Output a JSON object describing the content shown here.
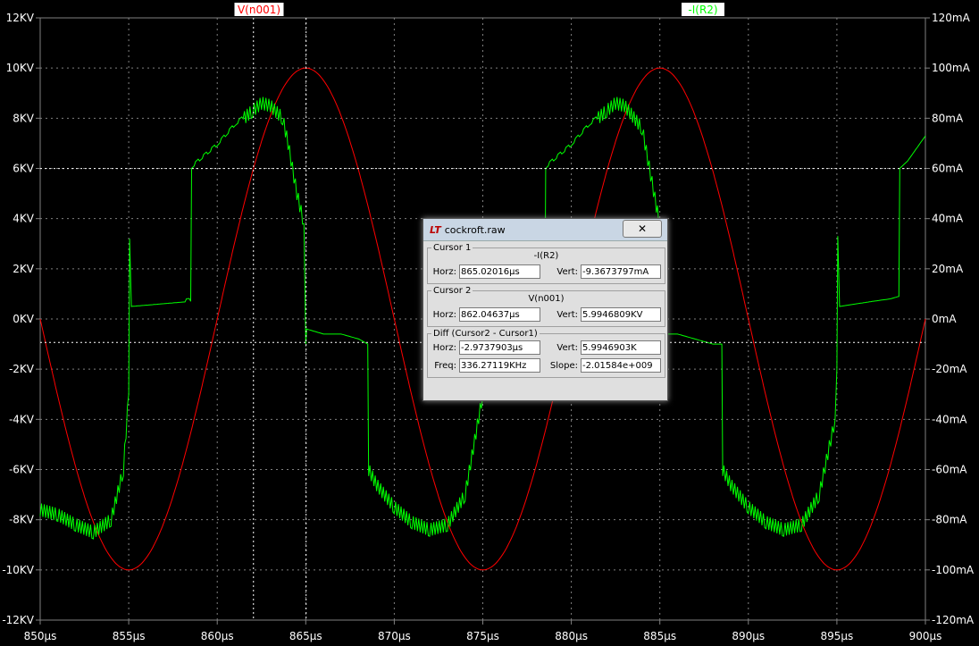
{
  "chart_data": {
    "type": "line",
    "x_axis": {
      "min": 850,
      "max": 900,
      "unit": "µs",
      "ticks": [
        "850µs",
        "855µs",
        "860µs",
        "865µs",
        "870µs",
        "875µs",
        "880µs",
        "885µs",
        "890µs",
        "895µs",
        "900µs"
      ]
    },
    "y_left": {
      "min": -12,
      "max": 12,
      "unit": "KV",
      "ticks": [
        "12KV",
        "10KV",
        "8KV",
        "6KV",
        "4KV",
        "2KV",
        "0KV",
        "-2KV",
        "-4KV",
        "-6KV",
        "-8KV",
        "-10KV",
        "-12KV"
      ]
    },
    "y_right": {
      "min": -120,
      "max": 120,
      "unit": "mA",
      "ticks": [
        "120mA",
        "100mA",
        "80mA",
        "60mA",
        "40mA",
        "20mA",
        "0mA",
        "-20mA",
        "-40mA",
        "-60mA",
        "-80mA",
        "-100mA",
        "-120mA"
      ]
    },
    "grid": true,
    "series": [
      {
        "name": "V(n001)",
        "color": "#ff0000",
        "axis": "left",
        "kind": "sine",
        "amplitude": 10,
        "period": 20,
        "peak_at": 865
      },
      {
        "name": "-I(R2)",
        "color": "#00ff00",
        "axis": "right",
        "kind": "piecewise",
        "points": [
          [
            850,
            -76
          ],
          [
            851,
            -78
          ],
          [
            852,
            -82
          ],
          [
            853,
            -85
          ],
          [
            854,
            -80
          ],
          [
            854.7,
            -60
          ],
          [
            855,
            -30
          ],
          [
            855.05,
            32
          ],
          [
            855.15,
            5
          ],
          [
            858.5,
            7
          ],
          [
            858.55,
            60
          ],
          [
            859,
            63
          ],
          [
            860,
            69
          ],
          [
            861,
            77
          ],
          [
            862,
            83
          ],
          [
            862.5,
            86
          ],
          [
            863,
            85
          ],
          [
            863.7,
            80
          ],
          [
            864,
            70
          ],
          [
            864.5,
            50
          ],
          [
            864.9,
            38
          ],
          [
            865,
            -10
          ],
          [
            865.05,
            -4
          ],
          [
            866,
            -6
          ],
          [
            867,
            -6
          ],
          [
            868,
            -8
          ],
          [
            868.5,
            -10
          ],
          [
            868.55,
            -60
          ],
          [
            869,
            -66
          ],
          [
            870,
            -75
          ],
          [
            871,
            -81
          ],
          [
            872,
            -84
          ],
          [
            873,
            -82
          ],
          [
            874,
            -70
          ],
          [
            875,
            -30
          ],
          [
            875.05,
            -2
          ],
          [
            876,
            -6
          ],
          [
            877,
            -7
          ],
          [
            878,
            -8
          ],
          [
            878.5,
            -10
          ],
          [
            878.55,
            60
          ],
          [
            879,
            63
          ],
          [
            880,
            69
          ],
          [
            881,
            77
          ],
          [
            882,
            83
          ],
          [
            882.5,
            86
          ],
          [
            883,
            85
          ],
          [
            884,
            76
          ],
          [
            884.8,
            45
          ],
          [
            885,
            38
          ],
          [
            885.05,
            -6
          ],
          [
            886,
            -6
          ],
          [
            887,
            -8
          ],
          [
            888,
            -10
          ],
          [
            888.5,
            -10
          ],
          [
            888.55,
            -60
          ],
          [
            889,
            -66
          ],
          [
            890,
            -75
          ],
          [
            891,
            -81
          ],
          [
            892,
            -84
          ],
          [
            893,
            -82
          ],
          [
            894,
            -70
          ],
          [
            894.9,
            -40
          ],
          [
            895,
            -20
          ],
          [
            895.05,
            33
          ],
          [
            895.15,
            5
          ],
          [
            897,
            7
          ],
          [
            898,
            8
          ],
          [
            898.5,
            9
          ],
          [
            898.55,
            60
          ],
          [
            899,
            63
          ],
          [
            900,
            73
          ]
        ],
        "ripple_intervals": [
          [
            850,
            855
          ],
          [
            861.5,
            865
          ],
          [
            868.5,
            875
          ],
          [
            881.5,
            885
          ],
          [
            888.5,
            895
          ]
        ]
      }
    ],
    "legend_labels": [
      {
        "text": "V(n001)",
        "color": "#ff0000",
        "bg": "#ffffff"
      },
      {
        "text": "-I(R2)",
        "color": "#00ff00",
        "bg": "#ffffff"
      }
    ],
    "cursors": [
      {
        "x": 862.04637,
        "y_left": 5.9946809
      },
      {
        "x": 865.02016,
        "y_right": -9.3673797
      }
    ]
  },
  "dialog": {
    "title": "cockroft.raw",
    "close": "✕",
    "cursor1": {
      "legend": "Cursor 1",
      "trace": "-I(R2)",
      "horz_label": "Horz:",
      "horz": "865.02016µs",
      "vert_label": "Vert:",
      "vert": "-9.3673797mA"
    },
    "cursor2": {
      "legend": "Cursor 2",
      "trace": "V(n001)",
      "horz_label": "Horz:",
      "horz": "862.04637µs",
      "vert_label": "Vert:",
      "vert": "5.9946809KV"
    },
    "diff": {
      "legend": "Diff (Cursor2 - Cursor1)",
      "horz_label": "Horz:",
      "horz": "-2.9737903µs",
      "vert_label": "Vert:",
      "vert": "5.9946903K",
      "freq_label": "Freq:",
      "freq": "336.27119KHz",
      "slope_label": "Slope:",
      "slope": "-2.01584e+009"
    }
  }
}
